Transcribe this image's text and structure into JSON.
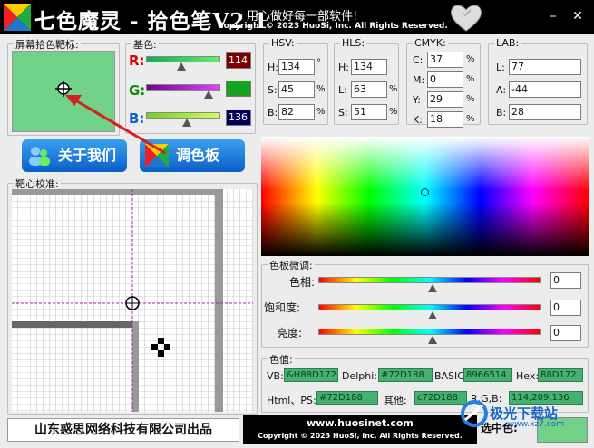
{
  "titlebar": {
    "app_title": "七色魔灵 - 拾色笔V2.1",
    "slogan": "用心做好每一部软件!",
    "copyright": "Copyright © 2023 HuoSi, Inc. All Rights Reserved.",
    "minimize": "–",
    "close": "✕"
  },
  "picker": {
    "label": "屏幕拾色靶标:",
    "preview_color": "#72D188"
  },
  "rgb": {
    "label": "基色:",
    "r_label": "R:",
    "r_value": "114",
    "g_label": "G:",
    "g_value": "209",
    "b_label": "B:",
    "b_value": "136",
    "colors": {
      "r": "#e00000",
      "g": "#0a8a0a",
      "b": "#1060d0"
    }
  },
  "hsv": {
    "label": "HSV:",
    "h_label": "H:",
    "h": "134",
    "h_unit": "°",
    "s_label": "S:",
    "s": "45",
    "s_unit": "%",
    "b_label": "B:",
    "b": "82",
    "b_unit": "%"
  },
  "hls": {
    "label": "HLS:",
    "h_label": "H:",
    "h": "134",
    "l_label": "L:",
    "l": "63",
    "l_unit": "%",
    "s_label": "S:",
    "s": "51",
    "s_unit": "%"
  },
  "cmyk": {
    "label": "CMYK:",
    "c_label": "C:",
    "c": "37",
    "m_label": "M:",
    "m": "0",
    "y_label": "Y:",
    "y": "29",
    "k_label": "K:",
    "k": "18",
    "unit": "%"
  },
  "lab": {
    "label": "LAB:",
    "l_label": "L:",
    "l": "77",
    "a_label": "A:",
    "a": "-44",
    "b_label": "B:",
    "b": "28"
  },
  "buttons": {
    "about": "关于我们",
    "palette": "调色板"
  },
  "magnifier": {
    "label": "靶心校准:"
  },
  "adjust": {
    "label": "色板微调:",
    "hue_label": "色相:",
    "hue_value": "0",
    "sat_label": "饱和度:",
    "sat_value": "0",
    "bri_label": "亮度:",
    "bri_value": "0"
  },
  "values": {
    "label": "色值:",
    "vb_label": "VB:",
    "vb": "&H88D172",
    "delphi_label": "Delphi:",
    "delphi": "#72D188",
    "basic_label": "BASIC:",
    "basic": "8966514",
    "hex_label": "Hex:",
    "hex": "88D172",
    "html_label": "Html、PS:",
    "html": "#72D188",
    "other_label": "其他:",
    "other": "c72D188",
    "rgb_label": "R,G,B:",
    "rgb": "114,209,136"
  },
  "footer": {
    "company": "山东惑思网络科技有限公司出品",
    "site": "www.huosinet.com",
    "copyright": "Copyright © 2023 HuoSi, Inc. All Rights Reserved.",
    "selected_label": "选中色:",
    "watermark": "极光下载站",
    "watermark_site": "www.xz7.com"
  }
}
